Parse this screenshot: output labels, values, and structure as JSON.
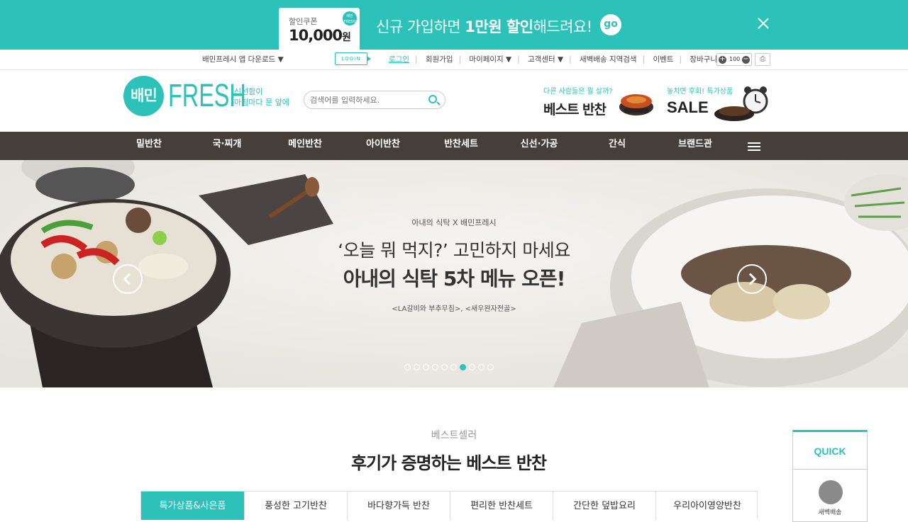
{
  "promo": {
    "coupon_label": "할인쿠폰",
    "coupon_amount": "10,000",
    "coupon_unit": "원",
    "badge_top": "배민",
    "badge_bottom": "FRESH",
    "text_pre": "신규 가입하면 ",
    "text_bold": "1만원 할인",
    "text_post": "해드려요!",
    "go_label": "go"
  },
  "util": {
    "app_download": "배민프레시 앱 다운로드 ▼",
    "login_badge": "LOGIN",
    "links": [
      "로그인",
      "회원가입",
      "마이페이지 ▼",
      "고객센터 ▼",
      "새벽배송 지역검색",
      "이벤트",
      "장바구니"
    ],
    "zoom_value": "100"
  },
  "header": {
    "logo_circle": "배민",
    "logo_text": "FRESH",
    "tagline_1": "신선함이",
    "tagline_2": "아침마다 문 앞에",
    "search_placeholder": "검색어를 입력하세요.",
    "banner1_small": "다른 사람들은 뭘 살까?",
    "banner1_big": "베스트 반찬",
    "banner2_small": "놓치면 후회! 특가상품",
    "banner2_big": "SALE"
  },
  "nav": [
    "밑반찬",
    "국·찌개",
    "메인반찬",
    "아이반찬",
    "반찬세트",
    "신선·가공",
    "간식",
    "브랜드관"
  ],
  "hero": {
    "sub": "아내의 식탁 X 배민프레시",
    "line1": "‘오늘 뭐 먹지?’ 고민하지 마세요",
    "line2": "아내의 식탁 5차 메뉴 오픈!",
    "caption": "<LA갈비와 부추무침>, <새우완자전골>",
    "slide_count": 10,
    "active_slide": 6
  },
  "best": {
    "subtitle": "베스트셀러",
    "title": "후기가 증명하는 베스트 반찬",
    "tabs": [
      "특가상품&사은품",
      "풍성한 고기반찬",
      "바다향가득 반찬",
      "편리한 반찬세트",
      "간단한 덮밥요리",
      "우리아이영양반찬"
    ]
  },
  "quick": {
    "title": "QUICK",
    "item_label": "새벽배송"
  },
  "colors": {
    "brand": "#2cc1b9",
    "nav_bg": "#463f39"
  }
}
